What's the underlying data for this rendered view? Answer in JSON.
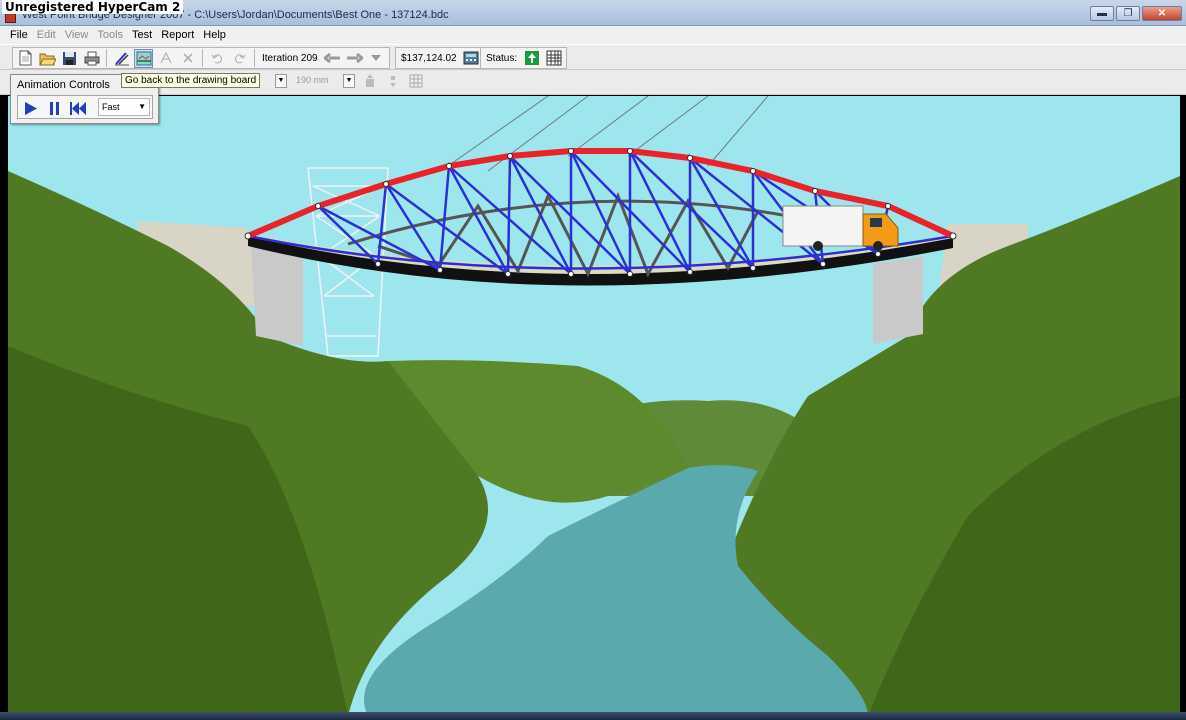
{
  "watermark": "Unregistered HyperCam 2",
  "window": {
    "title": "West Point Bridge Designer 2007 - C:\\Users\\Jordan\\Documents\\Best One - 137124.bdc",
    "minimize": "▬",
    "maximize": "❐",
    "close": "✕"
  },
  "menu": [
    {
      "label": "File",
      "enabled": true
    },
    {
      "label": "Edit",
      "enabled": false
    },
    {
      "label": "View",
      "enabled": false
    },
    {
      "label": "Tools",
      "enabled": false
    },
    {
      "label": "Test",
      "enabled": true
    },
    {
      "label": "Report",
      "enabled": true
    },
    {
      "label": "Help",
      "enabled": true
    }
  ],
  "toolbar": {
    "iteration_label": "Iteration 209",
    "cost": "$137,124.02",
    "status_label": "Status:"
  },
  "toolbar2": {
    "size_value": "190 mm"
  },
  "tooltip": "Go back to the drawing board",
  "animation_controls": {
    "title": "Animation Controls",
    "speed": "Fast"
  },
  "colors": {
    "sky": "#9ee6ee",
    "water": "#5aa9ad",
    "compression_member": "#e8232a",
    "tension_member": "#2c2fd8",
    "status_ok": "#1b9a3a"
  }
}
